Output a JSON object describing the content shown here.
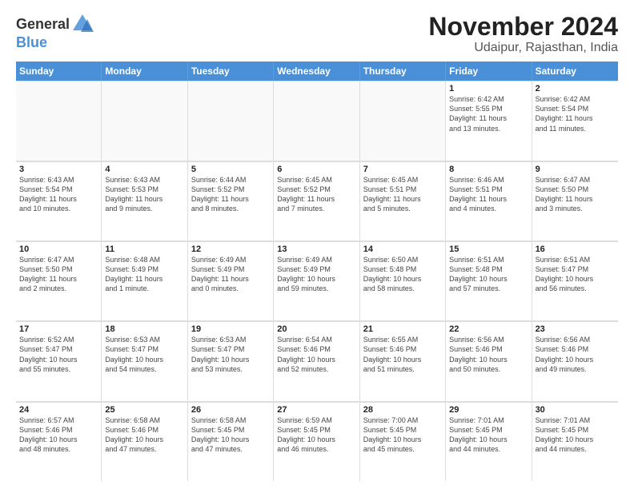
{
  "logo": {
    "general": "General",
    "blue": "Blue"
  },
  "title": "November 2024",
  "location": "Udaipur, Rajasthan, India",
  "days_header": [
    "Sunday",
    "Monday",
    "Tuesday",
    "Wednesday",
    "Thursday",
    "Friday",
    "Saturday"
  ],
  "weeks": [
    [
      {
        "day": "",
        "info": ""
      },
      {
        "day": "",
        "info": ""
      },
      {
        "day": "",
        "info": ""
      },
      {
        "day": "",
        "info": ""
      },
      {
        "day": "",
        "info": ""
      },
      {
        "day": "1",
        "info": "Sunrise: 6:42 AM\nSunset: 5:55 PM\nDaylight: 11 hours\nand 13 minutes."
      },
      {
        "day": "2",
        "info": "Sunrise: 6:42 AM\nSunset: 5:54 PM\nDaylight: 11 hours\nand 11 minutes."
      }
    ],
    [
      {
        "day": "3",
        "info": "Sunrise: 6:43 AM\nSunset: 5:54 PM\nDaylight: 11 hours\nand 10 minutes."
      },
      {
        "day": "4",
        "info": "Sunrise: 6:43 AM\nSunset: 5:53 PM\nDaylight: 11 hours\nand 9 minutes."
      },
      {
        "day": "5",
        "info": "Sunrise: 6:44 AM\nSunset: 5:52 PM\nDaylight: 11 hours\nand 8 minutes."
      },
      {
        "day": "6",
        "info": "Sunrise: 6:45 AM\nSunset: 5:52 PM\nDaylight: 11 hours\nand 7 minutes."
      },
      {
        "day": "7",
        "info": "Sunrise: 6:45 AM\nSunset: 5:51 PM\nDaylight: 11 hours\nand 5 minutes."
      },
      {
        "day": "8",
        "info": "Sunrise: 6:46 AM\nSunset: 5:51 PM\nDaylight: 11 hours\nand 4 minutes."
      },
      {
        "day": "9",
        "info": "Sunrise: 6:47 AM\nSunset: 5:50 PM\nDaylight: 11 hours\nand 3 minutes."
      }
    ],
    [
      {
        "day": "10",
        "info": "Sunrise: 6:47 AM\nSunset: 5:50 PM\nDaylight: 11 hours\nand 2 minutes."
      },
      {
        "day": "11",
        "info": "Sunrise: 6:48 AM\nSunset: 5:49 PM\nDaylight: 11 hours\nand 1 minute."
      },
      {
        "day": "12",
        "info": "Sunrise: 6:49 AM\nSunset: 5:49 PM\nDaylight: 11 hours\nand 0 minutes."
      },
      {
        "day": "13",
        "info": "Sunrise: 6:49 AM\nSunset: 5:49 PM\nDaylight: 10 hours\nand 59 minutes."
      },
      {
        "day": "14",
        "info": "Sunrise: 6:50 AM\nSunset: 5:48 PM\nDaylight: 10 hours\nand 58 minutes."
      },
      {
        "day": "15",
        "info": "Sunrise: 6:51 AM\nSunset: 5:48 PM\nDaylight: 10 hours\nand 57 minutes."
      },
      {
        "day": "16",
        "info": "Sunrise: 6:51 AM\nSunset: 5:47 PM\nDaylight: 10 hours\nand 56 minutes."
      }
    ],
    [
      {
        "day": "17",
        "info": "Sunrise: 6:52 AM\nSunset: 5:47 PM\nDaylight: 10 hours\nand 55 minutes."
      },
      {
        "day": "18",
        "info": "Sunrise: 6:53 AM\nSunset: 5:47 PM\nDaylight: 10 hours\nand 54 minutes."
      },
      {
        "day": "19",
        "info": "Sunrise: 6:53 AM\nSunset: 5:47 PM\nDaylight: 10 hours\nand 53 minutes."
      },
      {
        "day": "20",
        "info": "Sunrise: 6:54 AM\nSunset: 5:46 PM\nDaylight: 10 hours\nand 52 minutes."
      },
      {
        "day": "21",
        "info": "Sunrise: 6:55 AM\nSunset: 5:46 PM\nDaylight: 10 hours\nand 51 minutes."
      },
      {
        "day": "22",
        "info": "Sunrise: 6:56 AM\nSunset: 5:46 PM\nDaylight: 10 hours\nand 50 minutes."
      },
      {
        "day": "23",
        "info": "Sunrise: 6:56 AM\nSunset: 5:46 PM\nDaylight: 10 hours\nand 49 minutes."
      }
    ],
    [
      {
        "day": "24",
        "info": "Sunrise: 6:57 AM\nSunset: 5:46 PM\nDaylight: 10 hours\nand 48 minutes."
      },
      {
        "day": "25",
        "info": "Sunrise: 6:58 AM\nSunset: 5:46 PM\nDaylight: 10 hours\nand 47 minutes."
      },
      {
        "day": "26",
        "info": "Sunrise: 6:58 AM\nSunset: 5:45 PM\nDaylight: 10 hours\nand 47 minutes."
      },
      {
        "day": "27",
        "info": "Sunrise: 6:59 AM\nSunset: 5:45 PM\nDaylight: 10 hours\nand 46 minutes."
      },
      {
        "day": "28",
        "info": "Sunrise: 7:00 AM\nSunset: 5:45 PM\nDaylight: 10 hours\nand 45 minutes."
      },
      {
        "day": "29",
        "info": "Sunrise: 7:01 AM\nSunset: 5:45 PM\nDaylight: 10 hours\nand 44 minutes."
      },
      {
        "day": "30",
        "info": "Sunrise: 7:01 AM\nSunset: 5:45 PM\nDaylight: 10 hours\nand 44 minutes."
      }
    ]
  ]
}
